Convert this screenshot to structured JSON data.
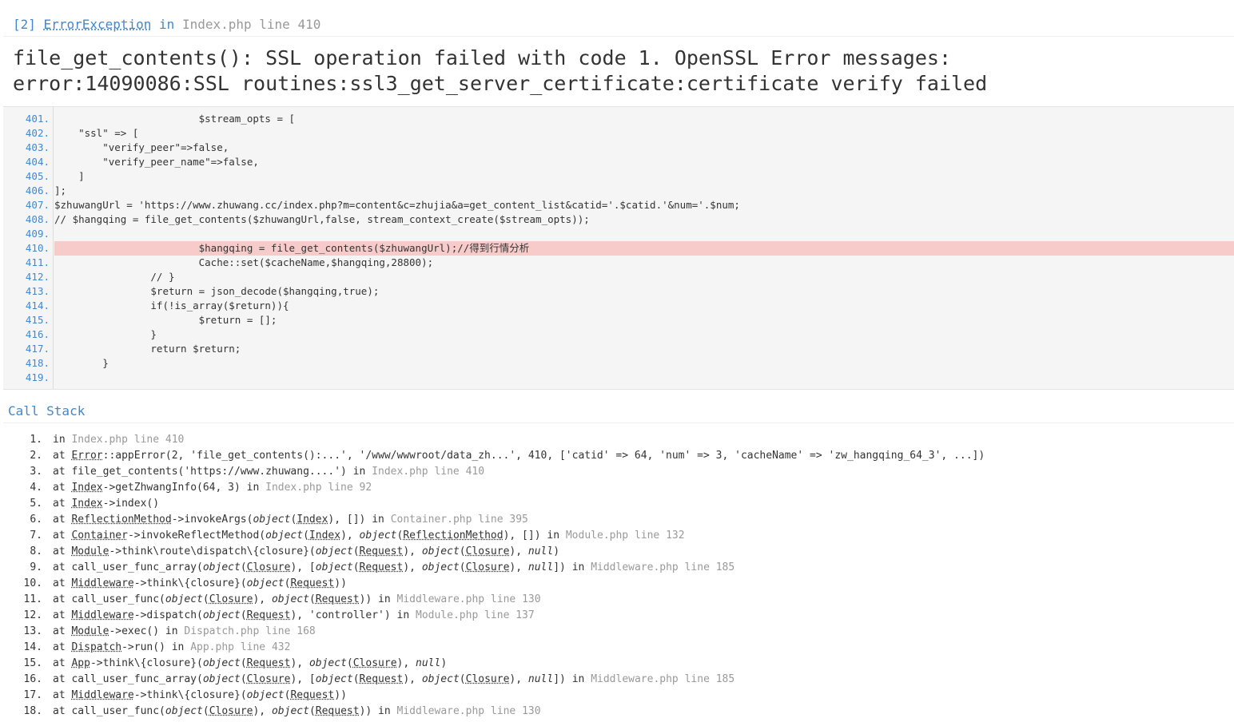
{
  "exception": {
    "index": "[2]",
    "class": "ErrorException",
    "in": "in",
    "file": "Index.php line 410"
  },
  "message": {
    "line1": "file_get_contents(): SSL operation failed with code 1. OpenSSL Error messages:",
    "line2": "error:14090086:SSL routines:ssl3_get_server_certificate:certificate verify failed"
  },
  "source": {
    "highlight_line": 410,
    "lines": [
      {
        "no": "401.",
        "code": "                        $stream_opts = ["
      },
      {
        "no": "402.",
        "code": "    \"ssl\" => ["
      },
      {
        "no": "403.",
        "code": "        \"verify_peer\"=>false,"
      },
      {
        "no": "404.",
        "code": "        \"verify_peer_name\"=>false,"
      },
      {
        "no": "405.",
        "code": "    ]"
      },
      {
        "no": "406.",
        "code": "];"
      },
      {
        "no": "407.",
        "code": "$zhuwangUrl = 'https://www.zhuwang.cc/index.php?m=content&c=zhujia&a=get_content_list&catid='.$catid.'&num='.$num;"
      },
      {
        "no": "408.",
        "code": "// $hangqing = file_get_contents($zhuwangUrl,false, stream_context_create($stream_opts));"
      },
      {
        "no": "409.",
        "code": ""
      },
      {
        "no": "410.",
        "code": "                        $hangqing = file_get_contents($zhuwangUrl);//得到行情分析"
      },
      {
        "no": "411.",
        "code": "                        Cache::set($cacheName,$hangqing,28800);"
      },
      {
        "no": "412.",
        "code": "                // }"
      },
      {
        "no": "413.",
        "code": "                $return = json_decode($hangqing,true);"
      },
      {
        "no": "414.",
        "code": "                if(!is_array($return)){"
      },
      {
        "no": "415.",
        "code": "                        $return = [];"
      },
      {
        "no": "416.",
        "code": "                }"
      },
      {
        "no": "417.",
        "code": "                return $return;"
      },
      {
        "no": "418.",
        "code": "        }"
      },
      {
        "no": "419.",
        "code": ""
      }
    ]
  },
  "call_stack": {
    "title": "Call Stack",
    "items": [
      {
        "n": "1.",
        "pre": "in ",
        "loc": "Index.php line 410"
      },
      {
        "n": "2.",
        "pre": "at ",
        "cls": "Error",
        "rest": "::appError(2, 'file_get_contents():...', '/www/wwwroot/data_zh...', 410, ['catid' => 64, 'num' => 3, 'cacheName' => 'zw_hangqing_64_3', ...])"
      },
      {
        "n": "3.",
        "pre": "at file_get_contents('https://www.zhuwang....') in ",
        "loc": "Index.php line 410"
      },
      {
        "n": "4.",
        "pre": "at ",
        "cls": "Index",
        "rest": "->getZhwangInfo(64, 3) in ",
        "loc": "Index.php line 92"
      },
      {
        "n": "5.",
        "pre": "at ",
        "cls": "Index",
        "rest": "->index()"
      },
      {
        "n": "6.",
        "pre": "at ",
        "cls": "ReflectionMethod",
        "rest": "->invokeArgs(object(Index), []) in ",
        "loc": "Container.php line 395"
      },
      {
        "n": "7.",
        "pre": "at ",
        "cls": "Container",
        "rest": "->invokeReflectMethod(object(Index), object(ReflectionMethod), []) in ",
        "loc": "Module.php line 132"
      },
      {
        "n": "8.",
        "pre": "at ",
        "cls": "Module",
        "rest": "->think\\route\\dispatch\\{closure}(object(Request), object(Closure), null)"
      },
      {
        "n": "9.",
        "pre": "at call_user_func_array(object(Closure), [object(Request), object(Closure), null]) in ",
        "loc": "Middleware.php line 185"
      },
      {
        "n": "10.",
        "pre": "at ",
        "cls": "Middleware",
        "rest": "->think\\{closure}(object(Request))"
      },
      {
        "n": "11.",
        "pre": "at call_user_func(object(Closure), object(Request)) in ",
        "loc": "Middleware.php line 130"
      },
      {
        "n": "12.",
        "pre": "at ",
        "cls": "Middleware",
        "rest": "->dispatch(object(Request), 'controller') in ",
        "loc": "Module.php line 137"
      },
      {
        "n": "13.",
        "pre": "at ",
        "cls": "Module",
        "rest": "->exec() in ",
        "loc": "Dispatch.php line 168"
      },
      {
        "n": "14.",
        "pre": "at ",
        "cls": "Dispatch",
        "rest": "->run() in ",
        "loc": "App.php line 432"
      },
      {
        "n": "15.",
        "pre": "at ",
        "cls": "App",
        "rest": "->think\\{closure}(object(Request), object(Closure), null)"
      },
      {
        "n": "16.",
        "pre": "at call_user_func_array(object(Closure), [object(Request), object(Closure), null]) in ",
        "loc": "Middleware.php line 185"
      },
      {
        "n": "17.",
        "pre": "at ",
        "cls": "Middleware",
        "rest": "->think\\{closure}(object(Request))"
      },
      {
        "n": "18.",
        "pre": "at call_user_func(object(Closure), object(Request)) in ",
        "loc": "Middleware.php line 130"
      }
    ]
  },
  "colors": {
    "link_blue": "#4288ce",
    "highlight_bg": "#f8cbcb",
    "source_bg": "#f5f5f5",
    "muted": "#999999"
  }
}
